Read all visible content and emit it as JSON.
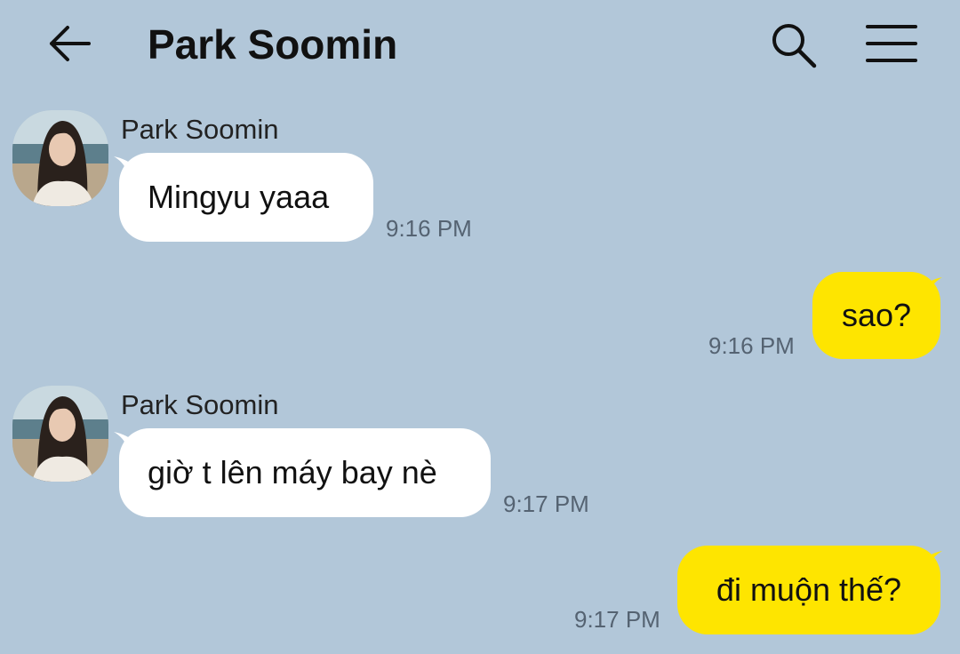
{
  "header": {
    "title": "Park Soomin",
    "back_icon": "arrow-left-icon",
    "search_icon": "search-icon",
    "menu_icon": "menu-icon"
  },
  "colors": {
    "background": "#b2c7d9",
    "incoming_bubble": "#ffffff",
    "outgoing_bubble": "#fee500"
  },
  "messages": [
    {
      "direction": "incoming",
      "sender": "Park Soomin",
      "text": "Mingyu yaaa",
      "time": "9:16 PM"
    },
    {
      "direction": "outgoing",
      "text": "sao?",
      "time": "9:16 PM"
    },
    {
      "direction": "incoming",
      "sender": "Park Soomin",
      "text": "giờ t lên máy bay nè",
      "time": "9:17 PM"
    },
    {
      "direction": "outgoing",
      "text": "đi muộn thế?",
      "time": "9:17 PM"
    }
  ]
}
